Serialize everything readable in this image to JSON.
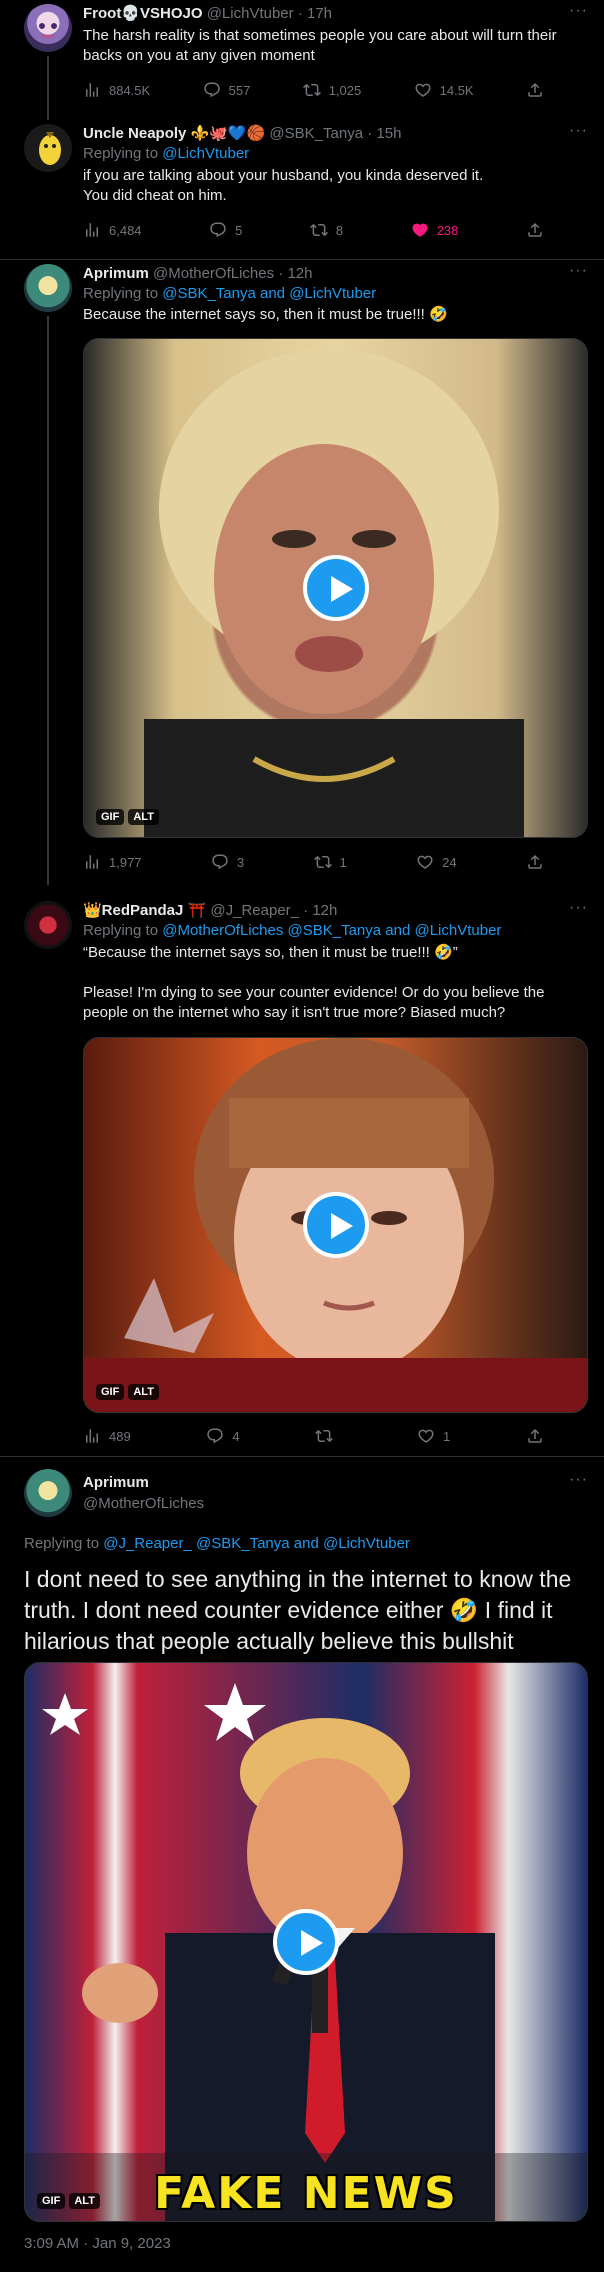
{
  "tweets": [
    {
      "name": "Froot💀VSHOJO",
      "handle": "@LichVtuber",
      "time": "17h",
      "text": "The harsh reality is that sometimes people you care about will turn their backs on you at any given moment",
      "views": "884.5K",
      "replies": "557",
      "retweets": "1,025",
      "likes": "14.5K"
    },
    {
      "name": "Uncle Neapoly ⚜️🐙💙🏀",
      "handle": "@SBK_Tanya",
      "time": "15h",
      "replying_label": "Replying to",
      "replying_to": "@LichVtuber",
      "text": "if you are talking about your husband, you kinda deserved it.\nYou did cheat on him.",
      "views": "6,484",
      "replies": "5",
      "retweets": "8",
      "likes": "238"
    },
    {
      "name": "Aprimum",
      "handle": "@MotherOfLiches",
      "time": "12h",
      "replying_label": "Replying to",
      "replying_to": "@SBK_Tanya and @LichVtuber",
      "text": "Because the internet says so, then it must be true!!! 🤣",
      "media_badges": [
        "GIF",
        "ALT"
      ],
      "views": "1,977",
      "replies": "3",
      "retweets": "1",
      "likes": "24"
    },
    {
      "name": "👑RedPandaJ ⛩️",
      "handle": "@J_Reaper_",
      "time": "12h",
      "replying_label": "Replying to",
      "replying_to": "@MotherOfLiches @SBK_Tanya and @LichVtuber",
      "text": "“Because the internet says so, then it must be true!!! 🤣”\n\nPlease! I'm dying to see your counter evidence! Or do you believe the people on the internet who say it isn't true more? Biased much?",
      "media_badges": [
        "GIF",
        "ALT"
      ],
      "views": "489",
      "replies": "4",
      "retweets": "",
      "likes": "1"
    }
  ],
  "main_tweet": {
    "name": "Aprimum",
    "handle": "@MotherOfLiches",
    "replying_label": "Replying to",
    "replying_to": "@J_Reaper_ @SBK_Tanya and @LichVtuber",
    "text": "I dont need to see anything in the internet to know the truth. I dont need counter evidence either 🤣 I find it hilarious that people actually believe this bullshit",
    "media_caption": "FAKE NEWS",
    "media_badges": [
      "GIF",
      "ALT"
    ],
    "timestamp": "3:09 AM · Jan 9, 2023"
  },
  "ui": {
    "more": "···",
    "dot": "·"
  },
  "colors": {
    "background": "#000000",
    "link": "#1d9bf0",
    "secondary_text": "#71767b",
    "like_active": "#f91880"
  }
}
